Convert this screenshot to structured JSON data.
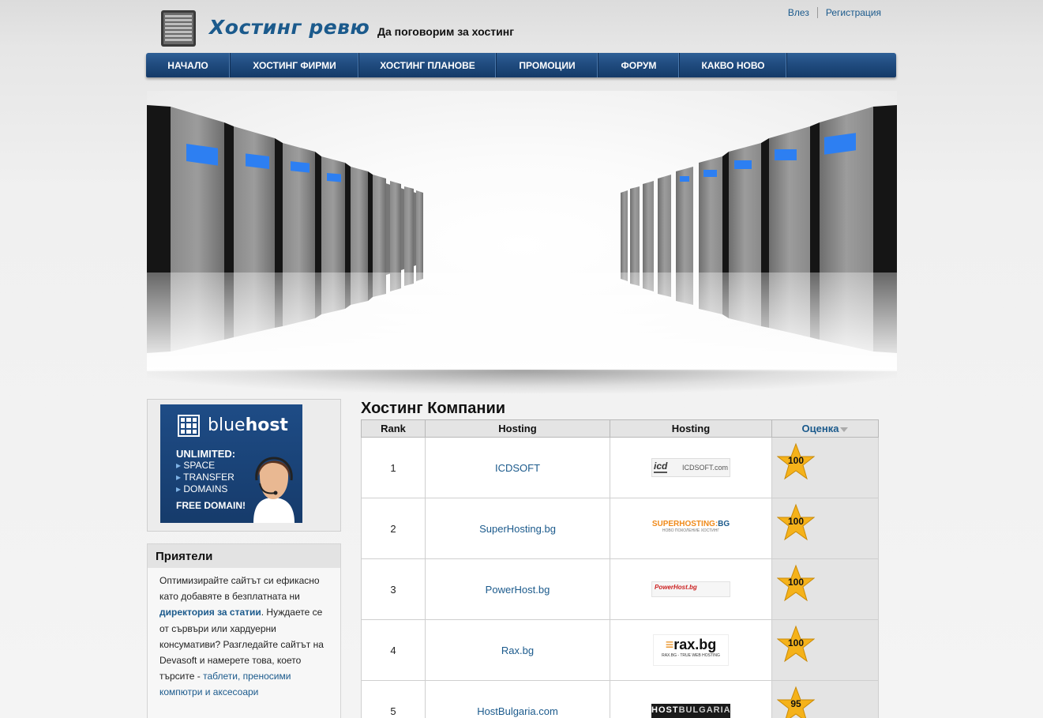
{
  "header": {
    "title": "Хостинг ревю",
    "tagline": "Да поговорим за хостинг",
    "login_label": "Влез",
    "register_label": "Регистрация",
    "logo_icon": "server-rack-icon"
  },
  "nav": {
    "items": [
      {
        "label": "НАЧАЛО"
      },
      {
        "label": "ХОСТИНГ ФИРМИ"
      },
      {
        "label": "ХОСТИНГ ПЛАНОВЕ"
      },
      {
        "label": "ПРОМОЦИИ"
      },
      {
        "label": "ФОРУМ"
      },
      {
        "label": "КАКВО НОВО"
      }
    ]
  },
  "ad": {
    "brand_light": "blue",
    "brand_bold": "host",
    "headline": "UNLIMITED:",
    "items": [
      "SPACE",
      "TRANSFER",
      "DOMAINS"
    ],
    "footer": "FREE DOMAIN!"
  },
  "friends": {
    "title": "Приятели",
    "text1": "Оптимизирайте сайтът си ефикасно като добавяте в безплатната ни",
    "link1": "директория за статии",
    "text2": ". Нуждаете се от сървъри или хардуерни консумативи? Разгледайте сайтът на Devasoft и намерете това, което търсите -",
    "link2": "таблети, преносими компютри и аксесоари"
  },
  "companies": {
    "title": "Хостинг Компании",
    "headers": {
      "rank": "Rank",
      "hosting": "Hosting",
      "hosting_logo": "Hosting",
      "rating": "Оценка"
    },
    "rows": [
      {
        "rank": "1",
        "name": "ICDSOFT",
        "logo_text": "ICDSOFT.com",
        "logo_mark": "icd",
        "score": "100"
      },
      {
        "rank": "2",
        "name": "SuperHosting.bg",
        "logo_text": "SUPERHOSTING",
        "logo_suffix": "BG",
        "logo_sub": "НОВО ПОКОЛЕНИЕ ХОСТИНГ",
        "score": "100"
      },
      {
        "rank": "3",
        "name": "PowerHost.bg",
        "logo_text": "PowerHost.bg",
        "score": "100"
      },
      {
        "rank": "4",
        "name": "Rax.bg",
        "logo_text": "rax.bg",
        "logo_sub": "RAX.BG - TRUE WEB HOSTING",
        "score": "100"
      },
      {
        "rank": "5",
        "name": "HostBulgaria.com",
        "logo_text": "HOST",
        "logo_suffix": "BULGARIA",
        "score": "95"
      }
    ]
  },
  "colors": {
    "accent": "#1b5a8c",
    "nav_bg": "#1f4a7d",
    "star": "#f5b21a"
  }
}
